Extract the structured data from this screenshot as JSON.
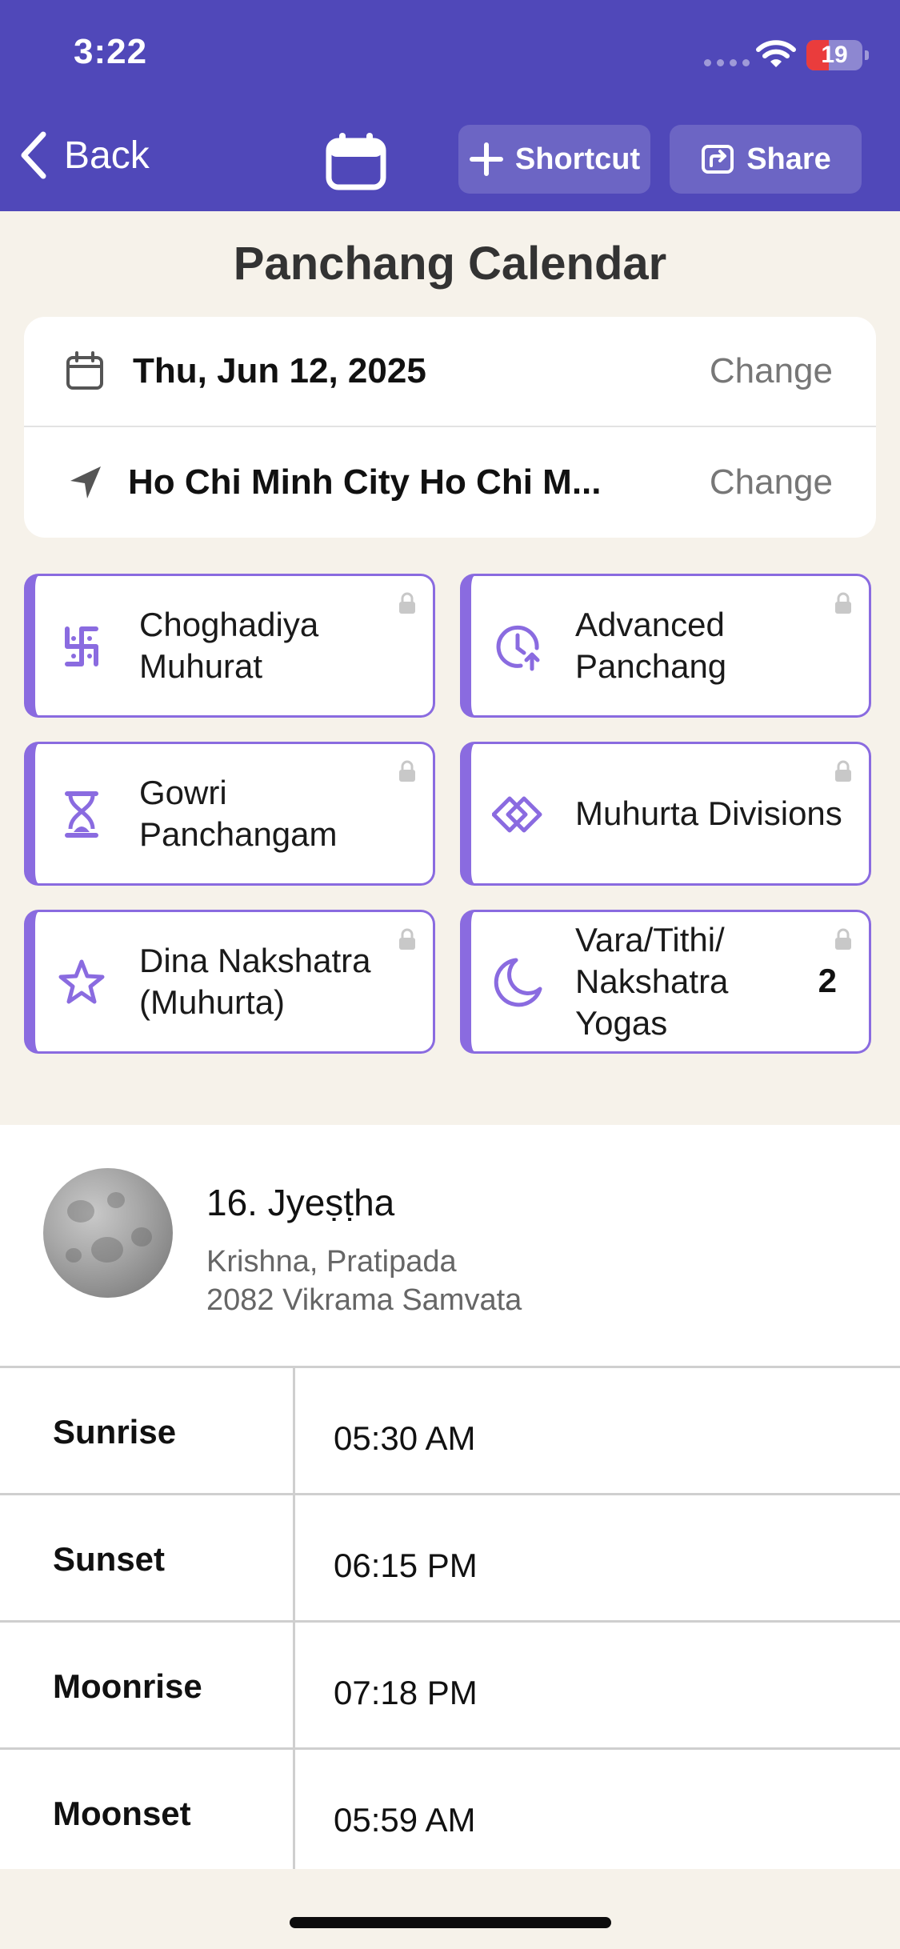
{
  "status_bar": {
    "time": "3:22",
    "battery": "19"
  },
  "nav": {
    "back_label": "Back",
    "shortcut_label": "Shortcut",
    "share_label": "Share"
  },
  "page_title": "Panchang Calendar",
  "date_row": {
    "value": "Thu, Jun 12, 2025",
    "action": "Change"
  },
  "location_row": {
    "value": "Ho Chi Minh City Ho Chi M...",
    "action": "Change"
  },
  "tiles": [
    {
      "label": "Choghadiya Muhurat",
      "icon": "swastika-icon"
    },
    {
      "label": "Advanced Panchang",
      "icon": "clock-arrow-icon"
    },
    {
      "label": "Gowri Panchangam",
      "icon": "hourglass-icon"
    },
    {
      "label": "Muhurta Divisions",
      "icon": "diamonds-icon"
    },
    {
      "label": "Dina Nakshatra (Muhurta)",
      "icon": "star-icon"
    },
    {
      "label": "Vara/Tithi/ Nakshatra Yogas",
      "icon": "moon-crescent-icon",
      "count": "2"
    }
  ],
  "summary": {
    "nakshatra": "16. Jyeṣṭha",
    "paksha_tithi": "Krishna, Pratipada",
    "samvat": "2082 Vikrama Samvata"
  },
  "times": [
    {
      "label": "Sunrise",
      "value": "05:30 AM"
    },
    {
      "label": "Sunset",
      "value": "06:15 PM"
    },
    {
      "label": "Moonrise",
      "value": "07:18 PM"
    },
    {
      "label": "Moonset",
      "value": "05:59 AM"
    }
  ],
  "colors": {
    "header": "#5048b9",
    "accent": "#8a6be0",
    "background": "#f6f2ea"
  }
}
